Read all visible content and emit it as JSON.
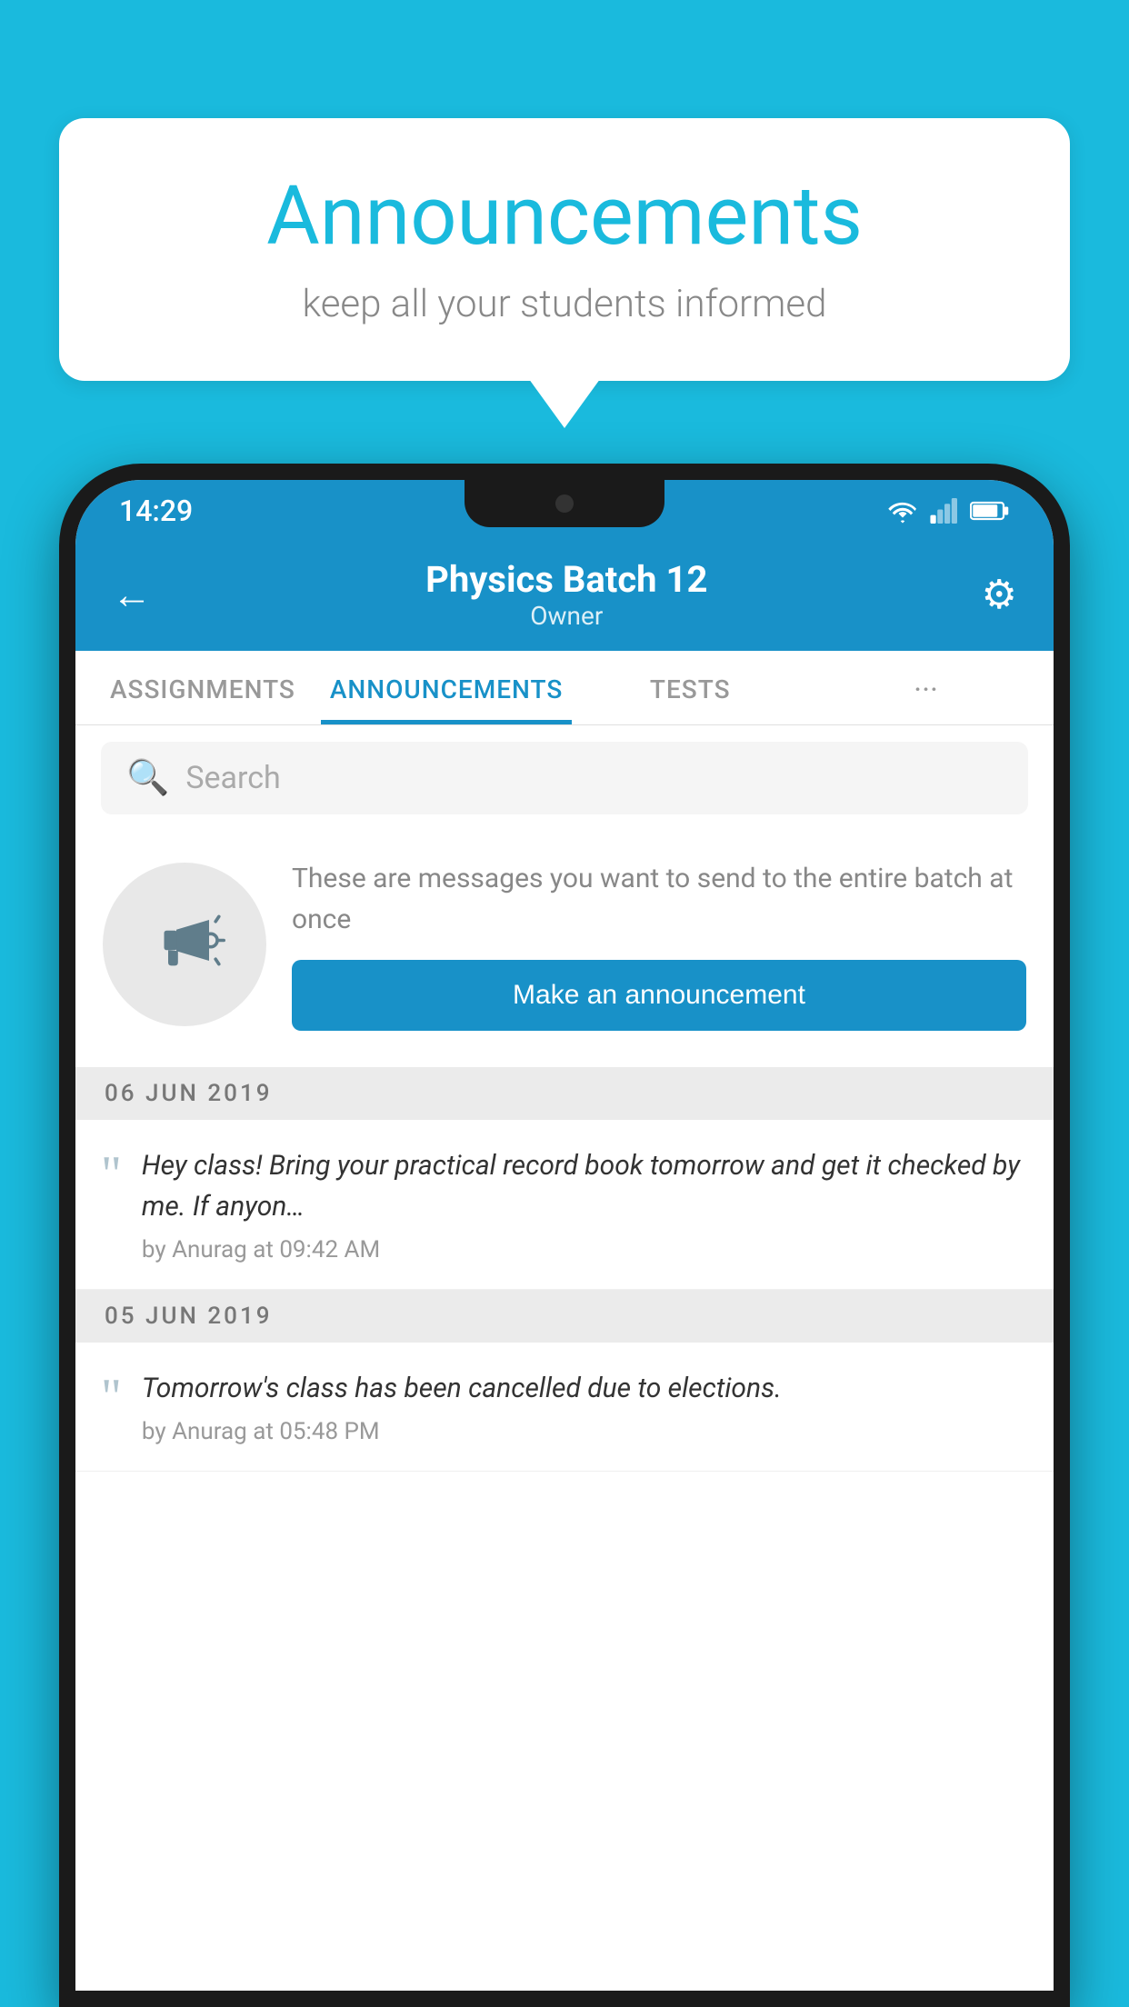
{
  "background_color": "#1ABADD",
  "speech_bubble": {
    "title": "Announcements",
    "subtitle": "keep all your students informed"
  },
  "status_bar": {
    "time": "14:29"
  },
  "header": {
    "title": "Physics Batch 12",
    "subtitle": "Owner",
    "back_label": "←",
    "gear_label": "⚙"
  },
  "tabs": [
    {
      "label": "ASSIGNMENTS",
      "active": false
    },
    {
      "label": "ANNOUNCEMENTS",
      "active": true
    },
    {
      "label": "TESTS",
      "active": false
    },
    {
      "label": "···",
      "active": false
    }
  ],
  "search": {
    "placeholder": "Search"
  },
  "announcement_prompt": {
    "description": "These are messages you want to send to the entire batch at once",
    "button_label": "Make an announcement"
  },
  "feed": [
    {
      "date": "06  JUN  2019",
      "items": [
        {
          "text": "Hey class! Bring your practical record book tomorrow and get it checked by me. If anyon…",
          "meta": "by Anurag at 09:42 AM"
        }
      ]
    },
    {
      "date": "05  JUN  2019",
      "items": [
        {
          "text": "Tomorrow's class has been cancelled due to elections.",
          "meta": "by Anurag at 05:48 PM"
        }
      ]
    }
  ]
}
